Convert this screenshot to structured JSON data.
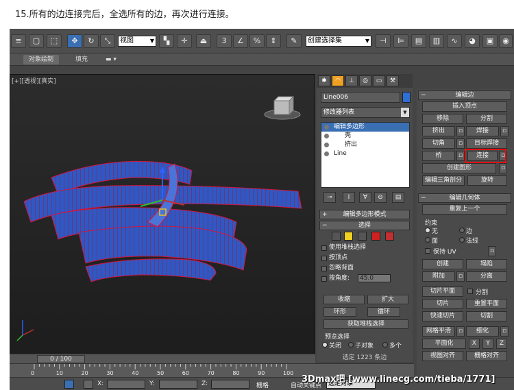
{
  "caption": "15.所有的边连接完后，全选所有的边，再次进行连接。",
  "toolbar": {
    "view_select": "视图",
    "selection_set": "创建选择集"
  },
  "ribbon": {
    "tabs": [
      "对象绘制",
      "填充"
    ]
  },
  "viewport": {
    "label": "[+][透视][真实]"
  },
  "command_panel": {
    "object_name": "Line006",
    "object_color": "#2d6fd5",
    "modifier_list": "修改器列表",
    "stack": [
      {
        "label": "编辑多边形",
        "selected": true
      },
      {
        "label": "壳",
        "selected": false
      },
      {
        "label": "挤出",
        "selected": false
      },
      {
        "label": "Line",
        "selected": false
      }
    ]
  },
  "edit_poly_mode": {
    "title": "编辑多边形模式"
  },
  "selection": {
    "title": "选择",
    "checks": [
      "使用堆栈选择",
      "按顶点",
      "忽略背面",
      "按角度:"
    ],
    "angle_value": "45.0",
    "shrink": "收缩",
    "grow": "扩大",
    "ring": "环形",
    "loop": "循环",
    "get_stack_selection": "获取堆栈选择",
    "preview_selection": "预览选择",
    "preview_options": [
      "关闭",
      "子对象",
      "多个"
    ],
    "status": "选定 1223 条边"
  },
  "edit_edges": {
    "title": "编辑边",
    "insert_vertex": "插入顶点",
    "remove": "移除",
    "split": "分割",
    "extrude": "挤出",
    "weld": "焊接",
    "chamfer": "切角",
    "target_weld": "目标焊接",
    "bridge": "桥",
    "connect": "连接",
    "create_shape": "创建图形",
    "edit_tri": "编辑三角剖分",
    "turn": "旋转"
  },
  "edit_geometry": {
    "title": "编辑几何体",
    "repeat_last": "重复上一个",
    "constraints": "约束",
    "constraint_options": [
      "无",
      "边",
      "面",
      "法线"
    ],
    "preserve_uv": "保持 UV",
    "create": "创建",
    "collapse": "塌陷",
    "attach": "附加",
    "detach": "分离",
    "slice_plane": "切片平面",
    "split_check": "分割",
    "slice": "切片",
    "reset_plane": "重置平面",
    "quickslice": "快速切片",
    "cut": "切割",
    "meshsmooth": "网格平滑",
    "tessellate": "细化",
    "make_planar": "平面化",
    "x": "X",
    "y": "Y",
    "z": "Z",
    "view_align": "视图对齐",
    "grid_align": "栅格对齐"
  },
  "timeline": {
    "frame": "0 / 100",
    "ticks": [
      "0",
      "10",
      "20",
      "30",
      "40",
      "50",
      "60",
      "70",
      "80",
      "90",
      "100"
    ]
  },
  "statusbar": {
    "x_label": "X:",
    "y_label": "Y:",
    "z_label": "Z:",
    "grid_label": "栅格",
    "autokey": "自动关键点",
    "selected_object": "选定对象"
  },
  "watermark": "3Dmax吧  [www.linecg.com/tieba/1771]"
}
